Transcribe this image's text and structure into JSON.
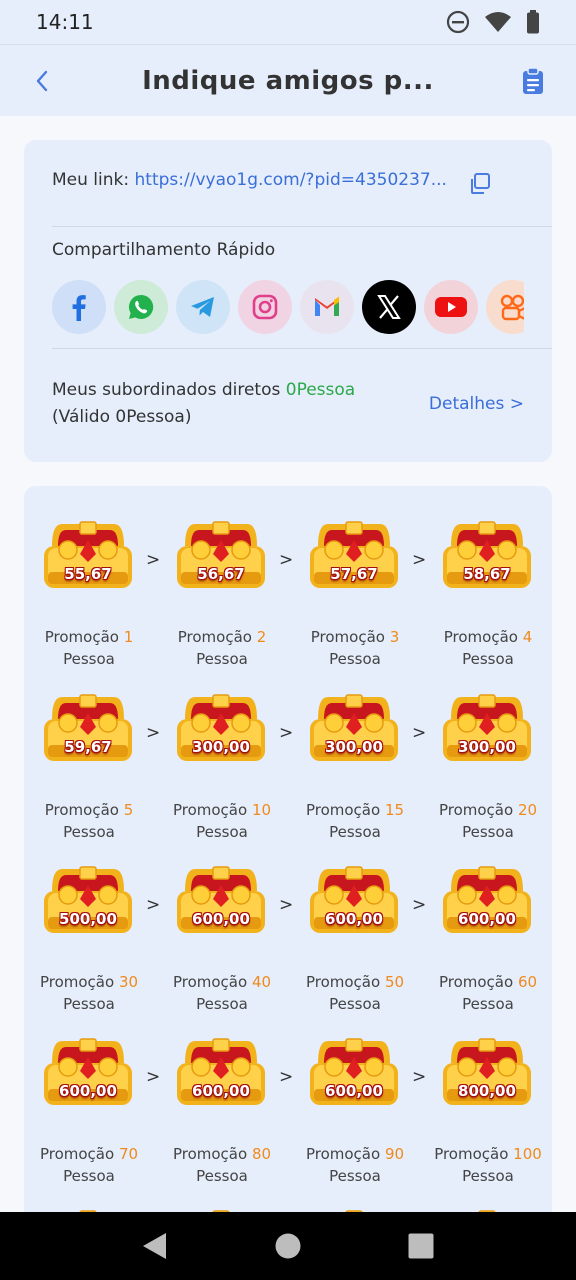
{
  "status": {
    "time": "14:11"
  },
  "header": {
    "title": "Indique amigos p..."
  },
  "link": {
    "label": "Meu link:",
    "url": "https://vyao1g.com/?pid=4350237..."
  },
  "share": {
    "title": "Compartilhamento Rápido",
    "icons": [
      "facebook-icon",
      "whatsapp-icon",
      "telegram-icon",
      "instagram-icon",
      "gmail-icon",
      "x-icon",
      "youtube-icon",
      "kwai-icon"
    ]
  },
  "subordinates": {
    "label": "Meus subordinados diretos",
    "count": "0Pessoa",
    "valid": "(Válido 0Pessoa)",
    "details": "Detalhes >"
  },
  "rewards": {
    "promo_word": "Promoção",
    "person_word": "Pessoa",
    "arrow": ">",
    "items": [
      {
        "value": "55,67",
        "count": "1"
      },
      {
        "value": "56,67",
        "count": "2"
      },
      {
        "value": "57,67",
        "count": "3"
      },
      {
        "value": "58,67",
        "count": "4"
      },
      {
        "value": "59,67",
        "count": "5"
      },
      {
        "value": "300,00",
        "count": "10"
      },
      {
        "value": "300,00",
        "count": "15"
      },
      {
        "value": "300,00",
        "count": "20"
      },
      {
        "value": "500,00",
        "count": "30"
      },
      {
        "value": "600,00",
        "count": "40"
      },
      {
        "value": "600,00",
        "count": "50"
      },
      {
        "value": "600,00",
        "count": "60"
      },
      {
        "value": "600,00",
        "count": "70"
      },
      {
        "value": "600,00",
        "count": "80"
      },
      {
        "value": "600,00",
        "count": "90"
      },
      {
        "value": "800,00",
        "count": "100"
      }
    ]
  },
  "colors": {
    "accent": "#3a6fd8",
    "count_green": "#2aa84a",
    "promo_orange": "#f08a1c",
    "card_bg": "#e6eefb"
  }
}
